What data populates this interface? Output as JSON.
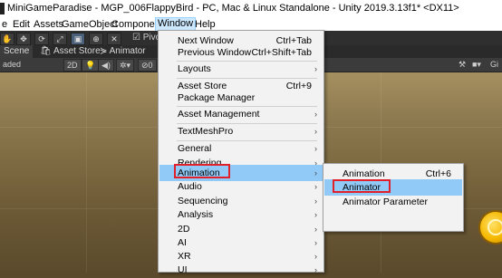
{
  "window": {
    "title": "MiniGameParadise - MGP_006FlappyBird - PC, Mac & Linux Standalone - Unity 2019.3.13f1* <DX11>"
  },
  "menubar": {
    "items": [
      "e",
      "Edit",
      "Assets",
      "GameObject",
      "Component",
      "Window",
      "Help"
    ],
    "active": "Window"
  },
  "toolbar": {
    "tools": [
      "hand-icon",
      "move-icon",
      "rotate-icon",
      "scale-icon",
      "rect-icon",
      "transform-icon",
      "custom-icon"
    ],
    "pivot_label": "Pivo"
  },
  "tabs": [
    {
      "label": "Scene",
      "icon": "scene-icon"
    },
    {
      "label": "Asset Store",
      "icon": "store-icon"
    },
    {
      "label": "Animator",
      "icon": "animator-icon"
    }
  ],
  "scene_toolbar": {
    "shading": "aded",
    "mode_2d": "2D",
    "gizmos": "Gi"
  },
  "window_menu": {
    "items": [
      {
        "label": "Next Window",
        "shortcut": "Ctrl+Tab"
      },
      {
        "label": "Previous Window",
        "shortcut": "Ctrl+Shift+Tab"
      },
      {
        "label": "Layouts",
        "submenu": true
      },
      {
        "label": "Asset Store",
        "shortcut": "Ctrl+9"
      },
      {
        "label": "Package Manager"
      },
      {
        "label": "Asset Management",
        "submenu": true
      },
      {
        "label": "TextMeshPro",
        "submenu": true
      },
      {
        "label": "General",
        "submenu": true
      },
      {
        "label": "Rendering",
        "submenu": true
      },
      {
        "label": "Animation",
        "submenu": true,
        "highlighted": true
      },
      {
        "label": "Audio",
        "submenu": true
      },
      {
        "label": "Sequencing",
        "submenu": true
      },
      {
        "label": "Analysis",
        "submenu": true
      },
      {
        "label": "2D",
        "submenu": true
      },
      {
        "label": "AI",
        "submenu": true
      },
      {
        "label": "XR",
        "submenu": true
      },
      {
        "label": "UI",
        "submenu": true
      }
    ]
  },
  "animation_submenu": {
    "items": [
      {
        "label": "Animation",
        "shortcut": "Ctrl+6"
      },
      {
        "label": "Animator",
        "highlighted": true
      },
      {
        "label": "Animator Parameter"
      }
    ]
  },
  "colors": {
    "menu_highlight": "#91c9f7",
    "annotation_box": "#e0202a",
    "scene_background": "#8e7a50"
  }
}
